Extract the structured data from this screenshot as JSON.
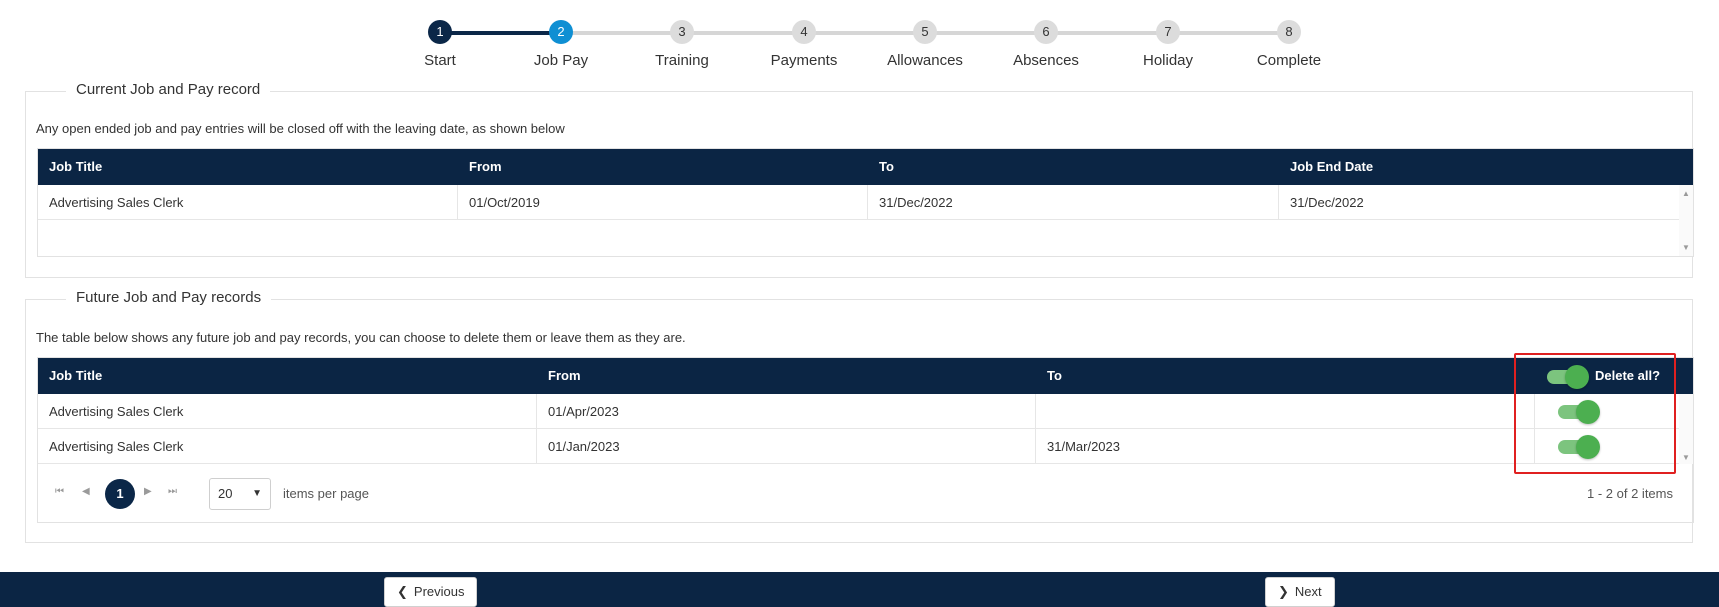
{
  "stepper": {
    "steps": [
      {
        "num": "1",
        "label": "Start"
      },
      {
        "num": "2",
        "label": "Job Pay"
      },
      {
        "num": "3",
        "label": "Training"
      },
      {
        "num": "4",
        "label": "Payments"
      },
      {
        "num": "5",
        "label": "Allowances"
      },
      {
        "num": "6",
        "label": "Absences"
      },
      {
        "num": "7",
        "label": "Holiday"
      },
      {
        "num": "8",
        "label": "Complete"
      }
    ],
    "current_step": 2
  },
  "current": {
    "legend": "Current Job and Pay record",
    "description": "Any open ended job and pay entries will be closed off with the leaving date, as shown below",
    "columns": [
      "Job Title",
      "From",
      "To",
      "Job End Date"
    ],
    "rows": [
      [
        "Advertising Sales Clerk",
        "01/Oct/2019",
        "31/Dec/2022",
        "31/Dec/2022"
      ]
    ]
  },
  "future": {
    "legend": "Future Job and Pay records",
    "description": "The table below shows any future job and pay records, you can choose to delete them or leave them as they are.",
    "columns": [
      "Job Title",
      "From",
      "To",
      "Delete all?"
    ],
    "rows": [
      [
        "Advertising Sales Clerk",
        "01/Apr/2023",
        ""
      ],
      [
        "Advertising Sales Clerk",
        "01/Jan/2023",
        "31/Mar/2023"
      ]
    ],
    "pager": {
      "page": "1",
      "page_size": "20",
      "items_per_page_label": "items per page",
      "info": "1 - 2 of 2 items"
    }
  },
  "footer": {
    "previous_label": "Previous",
    "next_label": "Next"
  },
  "colors": {
    "navy": "#0b2544",
    "active_step": "#0f8fd3",
    "toggle_on": "#4caf50",
    "highlight": "#e02020"
  }
}
